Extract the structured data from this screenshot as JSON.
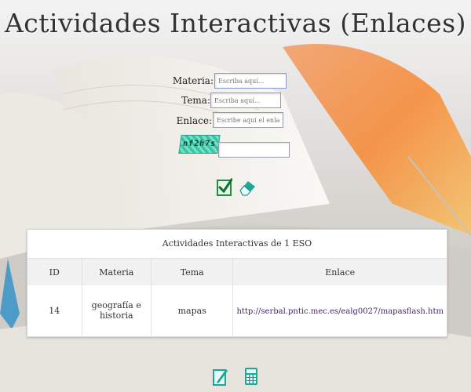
{
  "page": {
    "title": "Actividades Interactivas (Enlaces)"
  },
  "form": {
    "materia": {
      "label": "Materia:",
      "placeholder": "Escriba aquí..."
    },
    "tema": {
      "label": "Tema:",
      "placeholder": "Escriba aquí..."
    },
    "enlace": {
      "label": "Enlace:",
      "placeholder": "Escribe aquí el enlace."
    },
    "captcha": {
      "text": "nf2h7s",
      "value": ""
    },
    "actions": {
      "submit_icon": "check-icon",
      "clear_icon": "eraser-icon"
    }
  },
  "table": {
    "caption": "Actividades Interactivas de 1 ESO",
    "headers": [
      "ID",
      "Materia",
      "Tema",
      "Enlace"
    ],
    "rows": [
      {
        "id": "14",
        "materia": "geografía e historia",
        "tema": "mapas",
        "enlace": "http://serbal.pntic.mec.es/ealg0027/mapasflash.htm"
      }
    ]
  },
  "footer": {
    "edit_icon": "edit-icon",
    "calculator_icon": "calculator-icon"
  },
  "colors": {
    "accent_green": "#1e8f3a",
    "accent_teal": "#1aa89a",
    "link": "#4a1f6e"
  }
}
